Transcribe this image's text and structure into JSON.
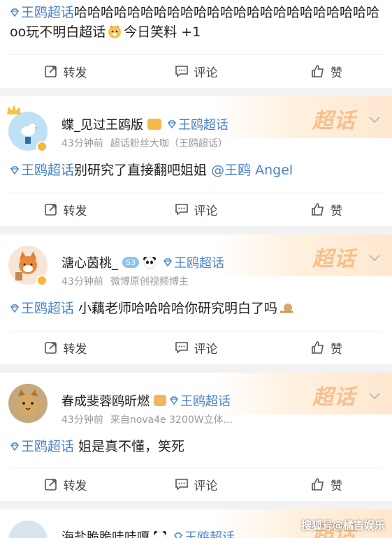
{
  "actions": {
    "repost": "转发",
    "comment": "评论",
    "like": "赞"
  },
  "posts": [
    {
      "topic": "王鸥超话",
      "text_a": "哈哈哈哈哈哈哈哈哈哈哈哈哈哈哈哈哈哈哈哈哈哈哈 oo玩不明白超话",
      "text_b": "今日笑料 +1"
    },
    {
      "user": "蝶_见过王鸥版",
      "topic_tag": "王鸥超话",
      "time": "43分钟前",
      "source": "超话粉丝大咖（王鸥超话）",
      "topic": "王鸥超话",
      "text_a": "别研究了直接翻吧姐姐",
      "mention": "@王鸥 Angel",
      "logo": "超话"
    },
    {
      "user": "溏心茵桃_",
      "level": "S3",
      "topic_tag": "王鸥超话",
      "time": "43分钟前",
      "source": "微博原创视频博主",
      "topic": "王鸥超话",
      "text_a": " 小藕老师哈哈哈哈你研究明白了吗",
      "logo": "超话"
    },
    {
      "user": "春成斐蓉鸥昕燃",
      "topic_tag": "王鸥超话",
      "time": "43分钟前",
      "source": "来自nova4e 3200W立体...",
      "topic": "王鸥超话",
      "text_a": " 姐是真不懂，笑死",
      "logo": "超话"
    },
    {
      "user": "海盐脆脆哇哇嘎",
      "topic_tag": "王鸥超话",
      "logo": "超话"
    }
  ],
  "watermark": "搜狐号@橘吉娱乐",
  "colors": {
    "topic": "#4a82c7",
    "logo": "#f7c08b",
    "badge": "#f6b73c"
  }
}
